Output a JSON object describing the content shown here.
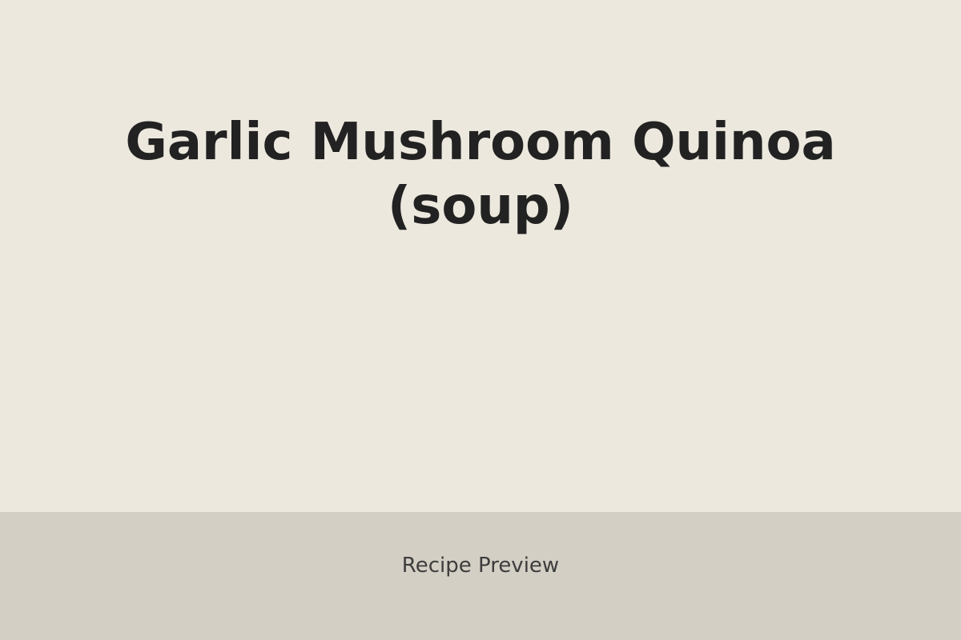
{
  "recipe": {
    "title_line1": "Garlic Mushroom Quinoa",
    "title_line2": "(soup)"
  },
  "footer": {
    "label": "Recipe Preview"
  },
  "colors": {
    "background": "#ede8de",
    "footer_background": "#d3cfc5",
    "title_text": "#222222",
    "footer_text": "#3d3d3d"
  }
}
